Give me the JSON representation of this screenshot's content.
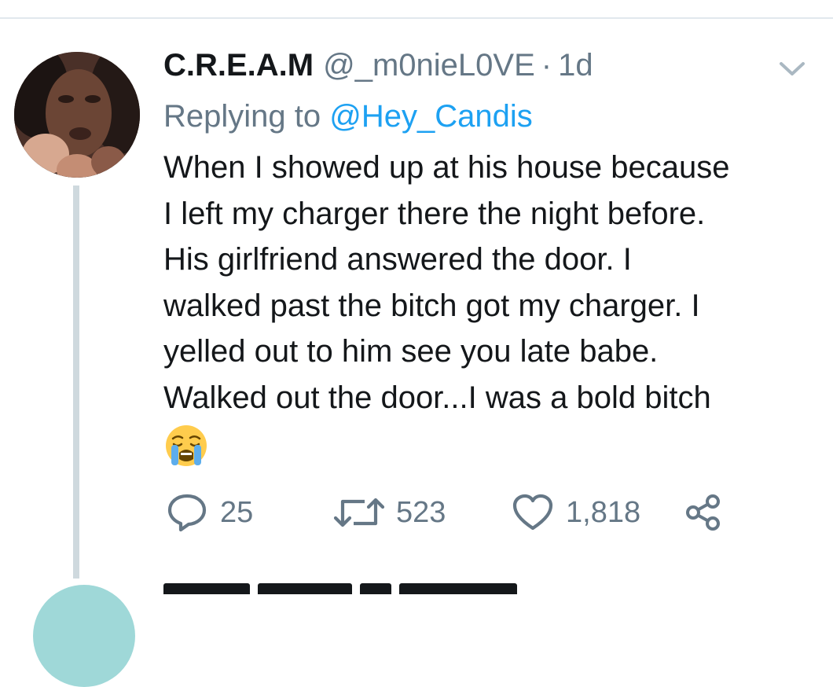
{
  "tweet": {
    "display_name": "C.R.E.A.M",
    "handle": "@_m0nieL0VE",
    "separator": "·",
    "timestamp": "1d",
    "replying_prefix": "Replying to",
    "replying_to": "@Hey_Candis",
    "text_lines": [
      "When I showed up at his house because",
      "I left my charger there the night before.",
      "His girlfriend answered the door. I",
      "walked past the bitch got my charger. I",
      "yelled out to him see you late babe.",
      "Walked out the door...I was a bold bitch"
    ],
    "emoji": "loudly-crying-face",
    "stats": {
      "replies": "25",
      "retweets": "523",
      "likes": "1,818"
    }
  },
  "icons": {
    "menu": "chevron-down-icon",
    "reply": "reply-icon",
    "retweet": "retweet-icon",
    "like": "heart-icon",
    "share": "share-icon"
  },
  "colors": {
    "text": "#14171a",
    "secondary": "#657786",
    "link": "#1da1f2",
    "thread_line": "#cfd9de",
    "divider": "#e1e8ed"
  }
}
